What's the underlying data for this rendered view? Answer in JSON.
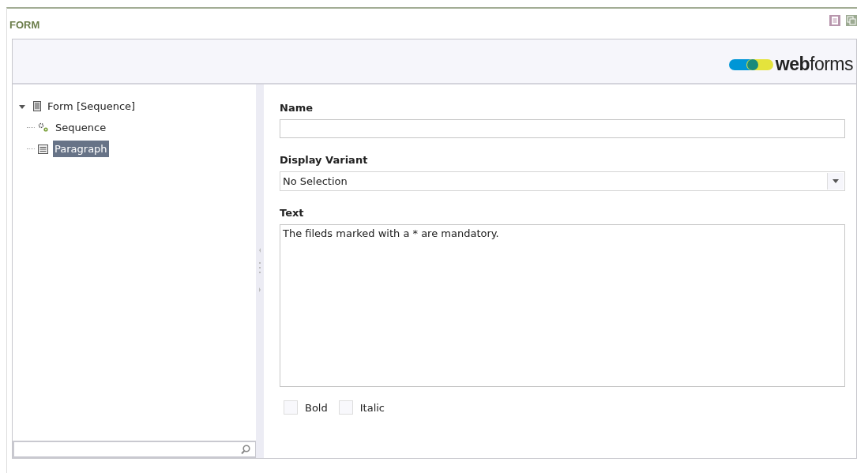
{
  "panel": {
    "title": "FORM"
  },
  "logo": {
    "text": "**web**forms"
  },
  "tree": [
    {
      "label": "Form [Sequence]",
      "kind": "form",
      "expanded": true,
      "selected": false,
      "children": [
        {
          "label": "Sequence",
          "kind": "gears",
          "selected": false
        },
        {
          "label": "Paragraph",
          "kind": "paragraph",
          "selected": true
        }
      ]
    }
  ],
  "fields": [
    {
      "kind": "text",
      "label": "Name"
    },
    {
      "kind": "select",
      "label": "Display Variant",
      "value": "No Selection"
    },
    {
      "kind": "textarea",
      "label": "Text",
      "value": "The fileds marked with a * are mandatory."
    }
  ],
  "checkboxes": [
    {
      "label": "Bold",
      "checked": false
    },
    {
      "label": "Italic",
      "checked": false
    }
  ]
}
